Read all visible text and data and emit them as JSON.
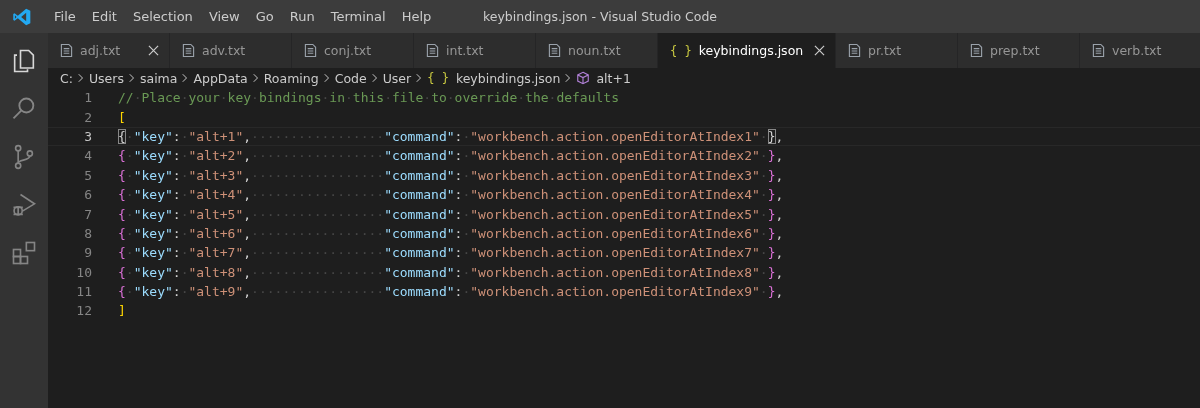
{
  "menu": [
    "File",
    "Edit",
    "Selection",
    "View",
    "Go",
    "Run",
    "Terminal",
    "Help"
  ],
  "window": {
    "title": "keybindings.json - Visual Studio Code"
  },
  "activity_bar": [
    {
      "kind": "explorer",
      "selected": true
    },
    {
      "kind": "search",
      "selected": false
    },
    {
      "kind": "source-control",
      "selected": false
    },
    {
      "kind": "run-debug",
      "selected": false
    },
    {
      "kind": "extensions",
      "selected": false
    }
  ],
  "tabs": [
    {
      "label": "adj.txt",
      "kind": "text",
      "selected": false,
      "close_visible": true
    },
    {
      "label": "adv.txt",
      "kind": "text",
      "selected": false,
      "close_visible": false
    },
    {
      "label": "conj.txt",
      "kind": "text",
      "selected": false,
      "close_visible": false
    },
    {
      "label": "int.txt",
      "kind": "text",
      "selected": false,
      "close_visible": false
    },
    {
      "label": "noun.txt",
      "kind": "text",
      "selected": false,
      "close_visible": false
    },
    {
      "label": "keybindings.json",
      "kind": "json",
      "icon": "{ }",
      "selected": true,
      "close_visible": true
    },
    {
      "label": "pr.txt",
      "kind": "text",
      "selected": false,
      "close_visible": false
    },
    {
      "label": "prep.txt",
      "kind": "text",
      "selected": false,
      "close_visible": false
    },
    {
      "label": "verb.txt",
      "kind": "text",
      "selected": false,
      "close_visible": false
    }
  ],
  "breadcrumb": [
    {
      "label": "C:",
      "kind": "folder"
    },
    {
      "label": "Users",
      "kind": "folder"
    },
    {
      "label": "saima",
      "kind": "folder"
    },
    {
      "label": "AppData",
      "kind": "folder"
    },
    {
      "label": "Roaming",
      "kind": "folder"
    },
    {
      "label": "Code",
      "kind": "folder"
    },
    {
      "label": "User",
      "kind": "folder"
    },
    {
      "label": "keybindings.json",
      "kind": "json",
      "icon": "{ }"
    },
    {
      "label": "alt+1",
      "kind": "symbol"
    }
  ],
  "editor": {
    "lines": [
      {
        "number": "1",
        "current": false,
        "tokens": [
          {
            "text": "//",
            "kind": "comment"
          },
          {
            "text": "·",
            "kind": "ws"
          },
          {
            "text": "Place",
            "kind": "comment"
          },
          {
            "text": "·",
            "kind": "ws"
          },
          {
            "text": "your",
            "kind": "comment"
          },
          {
            "text": "·",
            "kind": "ws"
          },
          {
            "text": "key",
            "kind": "comment"
          },
          {
            "text": "·",
            "kind": "ws"
          },
          {
            "text": "bindings",
            "kind": "comment"
          },
          {
            "text": "·",
            "kind": "ws"
          },
          {
            "text": "in",
            "kind": "comment"
          },
          {
            "text": "·",
            "kind": "ws"
          },
          {
            "text": "this",
            "kind": "comment"
          },
          {
            "text": "·",
            "kind": "ws"
          },
          {
            "text": "file",
            "kind": "comment"
          },
          {
            "text": "·",
            "kind": "ws"
          },
          {
            "text": "to",
            "kind": "comment"
          },
          {
            "text": "·",
            "kind": "ws"
          },
          {
            "text": "override",
            "kind": "comment"
          },
          {
            "text": "·",
            "kind": "ws"
          },
          {
            "text": "the",
            "kind": "comment"
          },
          {
            "text": "·",
            "kind": "ws"
          },
          {
            "text": "defaults",
            "kind": "comment"
          }
        ]
      },
      {
        "number": "2",
        "current": false,
        "tokens": [
          {
            "text": "[",
            "kind": "bracket1"
          }
        ]
      },
      {
        "number": "3",
        "current": true,
        "tokens": [
          {
            "text": "{",
            "kind": "bracket2",
            "match": true
          },
          {
            "text": "·",
            "kind": "ws"
          },
          {
            "text": "\"key\"",
            "kind": "key"
          },
          {
            "text": ":",
            "kind": "punct"
          },
          {
            "text": "·",
            "kind": "ws"
          },
          {
            "text": "\"alt+1\"",
            "kind": "str"
          },
          {
            "text": ",",
            "kind": "punct"
          },
          {
            "text": "·················",
            "kind": "ws"
          },
          {
            "text": "\"command\"",
            "kind": "key"
          },
          {
            "text": ":",
            "kind": "punct"
          },
          {
            "text": "·",
            "kind": "ws"
          },
          {
            "text": "\"workbench.action.openEditorAtIndex1\"",
            "kind": "str"
          },
          {
            "text": "·",
            "kind": "ws"
          },
          {
            "text": "}",
            "kind": "bracket2",
            "match": true
          },
          {
            "text": ",",
            "kind": "punct"
          }
        ]
      },
      {
        "number": "4",
        "current": false,
        "tokens": [
          {
            "text": "{",
            "kind": "bracket2",
            "match": false
          },
          {
            "text": "·",
            "kind": "ws"
          },
          {
            "text": "\"key\"",
            "kind": "key"
          },
          {
            "text": ":",
            "kind": "punct"
          },
          {
            "text": "·",
            "kind": "ws"
          },
          {
            "text": "\"alt+2\"",
            "kind": "str"
          },
          {
            "text": ",",
            "kind": "punct"
          },
          {
            "text": "·················",
            "kind": "ws"
          },
          {
            "text": "\"command\"",
            "kind": "key"
          },
          {
            "text": ":",
            "kind": "punct"
          },
          {
            "text": "·",
            "kind": "ws"
          },
          {
            "text": "\"workbench.action.openEditorAtIndex2\"",
            "kind": "str"
          },
          {
            "text": "·",
            "kind": "ws"
          },
          {
            "text": "}",
            "kind": "bracket2",
            "match": false
          },
          {
            "text": ",",
            "kind": "punct"
          }
        ]
      },
      {
        "number": "5",
        "current": false,
        "tokens": [
          {
            "text": "{",
            "kind": "bracket2",
            "match": false
          },
          {
            "text": "·",
            "kind": "ws"
          },
          {
            "text": "\"key\"",
            "kind": "key"
          },
          {
            "text": ":",
            "kind": "punct"
          },
          {
            "text": "·",
            "kind": "ws"
          },
          {
            "text": "\"alt+3\"",
            "kind": "str"
          },
          {
            "text": ",",
            "kind": "punct"
          },
          {
            "text": "·················",
            "kind": "ws"
          },
          {
            "text": "\"command\"",
            "kind": "key"
          },
          {
            "text": ":",
            "kind": "punct"
          },
          {
            "text": "·",
            "kind": "ws"
          },
          {
            "text": "\"workbench.action.openEditorAtIndex3\"",
            "kind": "str"
          },
          {
            "text": "·",
            "kind": "ws"
          },
          {
            "text": "}",
            "kind": "bracket2",
            "match": false
          },
          {
            "text": ",",
            "kind": "punct"
          }
        ]
      },
      {
        "number": "6",
        "current": false,
        "tokens": [
          {
            "text": "{",
            "kind": "bracket2",
            "match": false
          },
          {
            "text": "·",
            "kind": "ws"
          },
          {
            "text": "\"key\"",
            "kind": "key"
          },
          {
            "text": ":",
            "kind": "punct"
          },
          {
            "text": "·",
            "kind": "ws"
          },
          {
            "text": "\"alt+4\"",
            "kind": "str"
          },
          {
            "text": ",",
            "kind": "punct"
          },
          {
            "text": "·················",
            "kind": "ws"
          },
          {
            "text": "\"command\"",
            "kind": "key"
          },
          {
            "text": ":",
            "kind": "punct"
          },
          {
            "text": "·",
            "kind": "ws"
          },
          {
            "text": "\"workbench.action.openEditorAtIndex4\"",
            "kind": "str"
          },
          {
            "text": "·",
            "kind": "ws"
          },
          {
            "text": "}",
            "kind": "bracket2",
            "match": false
          },
          {
            "text": ",",
            "kind": "punct"
          }
        ]
      },
      {
        "number": "7",
        "current": false,
        "tokens": [
          {
            "text": "{",
            "kind": "bracket2",
            "match": false
          },
          {
            "text": "·",
            "kind": "ws"
          },
          {
            "text": "\"key\"",
            "kind": "key"
          },
          {
            "text": ":",
            "kind": "punct"
          },
          {
            "text": "·",
            "kind": "ws"
          },
          {
            "text": "\"alt+5\"",
            "kind": "str"
          },
          {
            "text": ",",
            "kind": "punct"
          },
          {
            "text": "·················",
            "kind": "ws"
          },
          {
            "text": "\"command\"",
            "kind": "key"
          },
          {
            "text": ":",
            "kind": "punct"
          },
          {
            "text": "·",
            "kind": "ws"
          },
          {
            "text": "\"workbench.action.openEditorAtIndex5\"",
            "kind": "str"
          },
          {
            "text": "·",
            "kind": "ws"
          },
          {
            "text": "}",
            "kind": "bracket2",
            "match": false
          },
          {
            "text": ",",
            "kind": "punct"
          }
        ]
      },
      {
        "number": "8",
        "current": false,
        "tokens": [
          {
            "text": "{",
            "kind": "bracket2",
            "match": false
          },
          {
            "text": "·",
            "kind": "ws"
          },
          {
            "text": "\"key\"",
            "kind": "key"
          },
          {
            "text": ":",
            "kind": "punct"
          },
          {
            "text": "·",
            "kind": "ws"
          },
          {
            "text": "\"alt+6\"",
            "kind": "str"
          },
          {
            "text": ",",
            "kind": "punct"
          },
          {
            "text": "·················",
            "kind": "ws"
          },
          {
            "text": "\"command\"",
            "kind": "key"
          },
          {
            "text": ":",
            "kind": "punct"
          },
          {
            "text": "·",
            "kind": "ws"
          },
          {
            "text": "\"workbench.action.openEditorAtIndex6\"",
            "kind": "str"
          },
          {
            "text": "·",
            "kind": "ws"
          },
          {
            "text": "}",
            "kind": "bracket2",
            "match": false
          },
          {
            "text": ",",
            "kind": "punct"
          }
        ]
      },
      {
        "number": "9",
        "current": false,
        "tokens": [
          {
            "text": "{",
            "kind": "bracket2",
            "match": false
          },
          {
            "text": "·",
            "kind": "ws"
          },
          {
            "text": "\"key\"",
            "kind": "key"
          },
          {
            "text": ":",
            "kind": "punct"
          },
          {
            "text": "·",
            "kind": "ws"
          },
          {
            "text": "\"alt+7\"",
            "kind": "str"
          },
          {
            "text": ",",
            "kind": "punct"
          },
          {
            "text": "·················",
            "kind": "ws"
          },
          {
            "text": "\"command\"",
            "kind": "key"
          },
          {
            "text": ":",
            "kind": "punct"
          },
          {
            "text": "·",
            "kind": "ws"
          },
          {
            "text": "\"workbench.action.openEditorAtIndex7\"",
            "kind": "str"
          },
          {
            "text": "·",
            "kind": "ws"
          },
          {
            "text": "}",
            "kind": "bracket2",
            "match": false
          },
          {
            "text": ",",
            "kind": "punct"
          }
        ]
      },
      {
        "number": "10",
        "current": false,
        "tokens": [
          {
            "text": "{",
            "kind": "bracket2",
            "match": false
          },
          {
            "text": "·",
            "kind": "ws"
          },
          {
            "text": "\"key\"",
            "kind": "key"
          },
          {
            "text": ":",
            "kind": "punct"
          },
          {
            "text": "·",
            "kind": "ws"
          },
          {
            "text": "\"alt+8\"",
            "kind": "str"
          },
          {
            "text": ",",
            "kind": "punct"
          },
          {
            "text": "·················",
            "kind": "ws"
          },
          {
            "text": "\"command\"",
            "kind": "key"
          },
          {
            "text": ":",
            "kind": "punct"
          },
          {
            "text": "·",
            "kind": "ws"
          },
          {
            "text": "\"workbench.action.openEditorAtIndex8\"",
            "kind": "str"
          },
          {
            "text": "·",
            "kind": "ws"
          },
          {
            "text": "}",
            "kind": "bracket2",
            "match": false
          },
          {
            "text": ",",
            "kind": "punct"
          }
        ]
      },
      {
        "number": "11",
        "current": false,
        "tokens": [
          {
            "text": "{",
            "kind": "bracket2",
            "match": false
          },
          {
            "text": "·",
            "kind": "ws"
          },
          {
            "text": "\"key\"",
            "kind": "key"
          },
          {
            "text": ":",
            "kind": "punct"
          },
          {
            "text": "·",
            "kind": "ws"
          },
          {
            "text": "\"alt+9\"",
            "kind": "str"
          },
          {
            "text": ",",
            "kind": "punct"
          },
          {
            "text": "·················",
            "kind": "ws"
          },
          {
            "text": "\"command\"",
            "kind": "key"
          },
          {
            "text": ":",
            "kind": "punct"
          },
          {
            "text": "·",
            "kind": "ws"
          },
          {
            "text": "\"workbench.action.openEditorAtIndex9\"",
            "kind": "str"
          },
          {
            "text": "·",
            "kind": "ws"
          },
          {
            "text": "}",
            "kind": "bracket2",
            "match": false
          },
          {
            "text": ",",
            "kind": "punct"
          }
        ]
      },
      {
        "number": "12",
        "current": false,
        "tokens": [
          {
            "text": "]",
            "kind": "bracket1"
          }
        ]
      }
    ]
  }
}
